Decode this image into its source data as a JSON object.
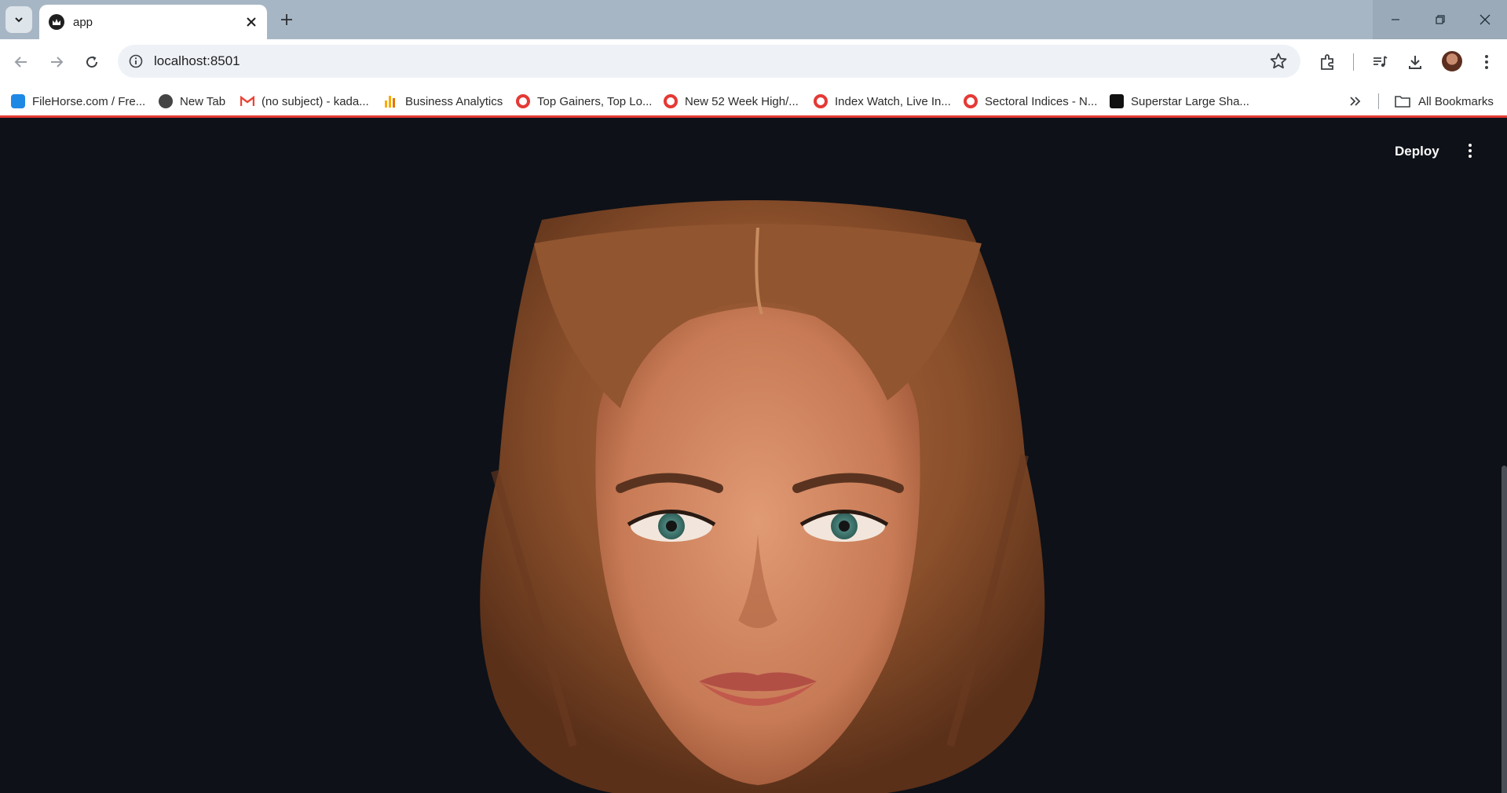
{
  "browser": {
    "tab_title": "app",
    "url": "localhost:8501",
    "bookmarks": [
      {
        "label": "FileHorse.com / Fre...",
        "icon": "filehorse-icon",
        "color": "#1e88e5"
      },
      {
        "label": "New Tab",
        "icon": "globe-icon",
        "color": "#444444"
      },
      {
        "label": "(no subject) - kada...",
        "icon": "gmail-icon",
        "color": "#ea4335"
      },
      {
        "label": "Business Analytics",
        "icon": "analytics-icon",
        "color": "#f9ab00"
      },
      {
        "label": "Top Gainers, Top Lo...",
        "icon": "site-icon",
        "color": "#e53935"
      },
      {
        "label": "New 52 Week High/...",
        "icon": "site-icon",
        "color": "#e53935"
      },
      {
        "label": "Index Watch, Live In...",
        "icon": "site-icon",
        "color": "#e53935"
      },
      {
        "label": "Sectoral Indices - N...",
        "icon": "site-icon",
        "color": "#e53935"
      },
      {
        "label": "Superstar Large Sha...",
        "icon": "tradingview-icon",
        "color": "#111111"
      }
    ],
    "all_bookmarks_label": "All Bookmarks"
  },
  "app": {
    "deploy_label": "Deploy",
    "background": "#0e1117",
    "image": {
      "subject": "generated portrait image",
      "icon": "portrait-image"
    }
  }
}
